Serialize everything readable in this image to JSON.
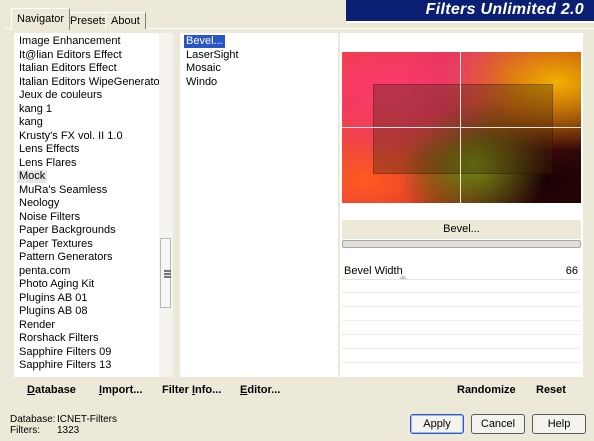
{
  "app_title": "Filters Unlimited 2.0",
  "tabs": [
    {
      "label": "Navigator",
      "active": true
    },
    {
      "label": "Presets",
      "active": false
    },
    {
      "label": "About",
      "active": false
    }
  ],
  "categories": [
    {
      "label": "Image Enhancement",
      "selected": false
    },
    {
      "label": "It@lian Editors Effect",
      "selected": false
    },
    {
      "label": "Italian Editors Effect",
      "selected": false
    },
    {
      "label": "Italian Editors WipeGenerator",
      "selected": false
    },
    {
      "label": "Jeux de couleurs",
      "selected": false
    },
    {
      "label": "kang 1",
      "selected": false
    },
    {
      "label": "kang",
      "selected": false
    },
    {
      "label": "Krusty's FX vol. II 1.0",
      "selected": false
    },
    {
      "label": "Lens Effects",
      "selected": false
    },
    {
      "label": "Lens Flares",
      "selected": false
    },
    {
      "label": "Mock",
      "selected": true
    },
    {
      "label": "MuRa's Seamless",
      "selected": false
    },
    {
      "label": "Neology",
      "selected": false
    },
    {
      "label": "Noise Filters",
      "selected": false
    },
    {
      "label": "Paper Backgrounds",
      "selected": false
    },
    {
      "label": "Paper Textures",
      "selected": false
    },
    {
      "label": "Pattern Generators",
      "selected": false
    },
    {
      "label": "penta.com",
      "selected": false
    },
    {
      "label": "Photo Aging Kit",
      "selected": false
    },
    {
      "label": "Plugins AB 01",
      "selected": false
    },
    {
      "label": "Plugins AB 08",
      "selected": false
    },
    {
      "label": "Render",
      "selected": false
    },
    {
      "label": "Rorshack Filters",
      "selected": false
    },
    {
      "label": "Sapphire Filters 09",
      "selected": false
    },
    {
      "label": "Sapphire Filters 13",
      "selected": false
    }
  ],
  "filters": [
    {
      "label": "Bevel...",
      "selected": true
    },
    {
      "label": "LaserSight",
      "selected": false
    },
    {
      "label": "Mosaic",
      "selected": false
    },
    {
      "label": "Windo",
      "selected": false
    }
  ],
  "filter_name_button": "Bevel...",
  "parameter": {
    "name": "Bevel Width",
    "value": "66"
  },
  "left_actions": {
    "database": {
      "ul": "D",
      "rest": "atabase"
    },
    "import": {
      "ul": "I",
      "rest": "mport..."
    },
    "filter_info": {
      "pre": "Filter ",
      "ul": "I",
      "post": "nfo..."
    },
    "editor": {
      "ul": "E",
      "rest": "ditor..."
    }
  },
  "right_actions": {
    "randomize": "Randomize",
    "reset": "Reset"
  },
  "status": {
    "database_label": "Database:",
    "database_value": "ICNET-Filters",
    "filters_label": "Filters:",
    "filters_value": "1323"
  },
  "dialog_buttons": {
    "apply": "Apply",
    "cancel": "Cancel",
    "help": "Help"
  },
  "colors": {
    "banner": "#0a1f73",
    "selection": "#2a55c8"
  }
}
